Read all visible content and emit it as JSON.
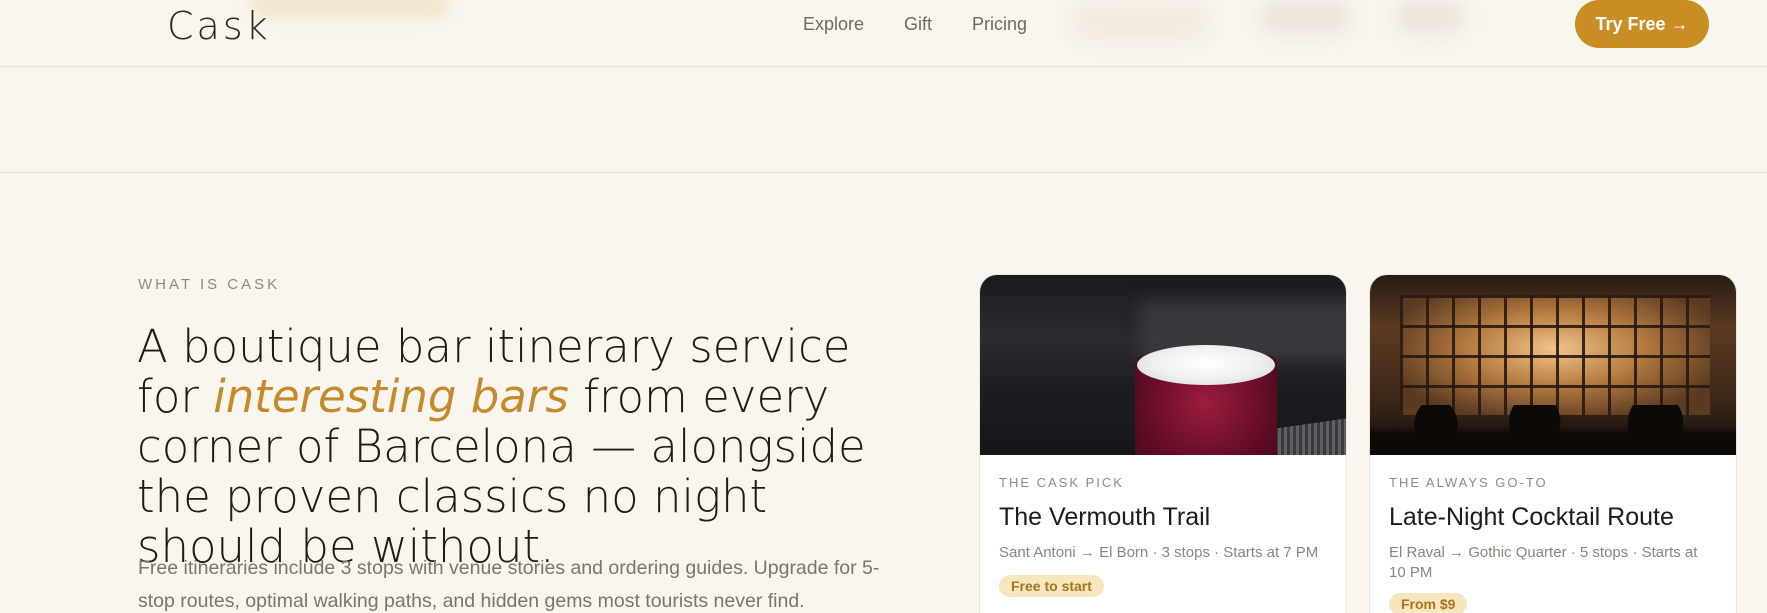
{
  "header": {
    "logo": "Cask",
    "nav": [
      "Explore",
      "Gift",
      "Pricing"
    ],
    "cta_label": "Try Free →"
  },
  "section": {
    "eyebrow": "WHAT IS CASK",
    "headline_part1": "A boutique bar itinerary service for",
    "headline_emphasis": "interesting bars",
    "headline_part2": "from every corner of Barcelona — alongside the proven classics no night should be without.",
    "lede": "Free itineraries include 3 stops with venue stories and ordering guides. Upgrade for 5-stop routes, optimal walking paths, and hidden gems most tourists never find."
  },
  "cards": [
    {
      "eyebrow": "THE CASK PICK",
      "title": "The Vermouth Trail",
      "meta": "Sant Antoni → El Born · 3 stops · Starts at 7 PM",
      "badge": "Free to start"
    },
    {
      "eyebrow": "THE ALWAYS GO-TO",
      "title": "Late-Night Cocktail Route",
      "meta": "El Raval → Gothic Quarter · 5 stops · Starts at 10 PM",
      "badge": "From $9"
    }
  ],
  "colors": {
    "background": "#f9f5ef",
    "accent": "#c98f24",
    "emphasis": "#c48a2b",
    "badge_bg": "#f6e7bf"
  }
}
